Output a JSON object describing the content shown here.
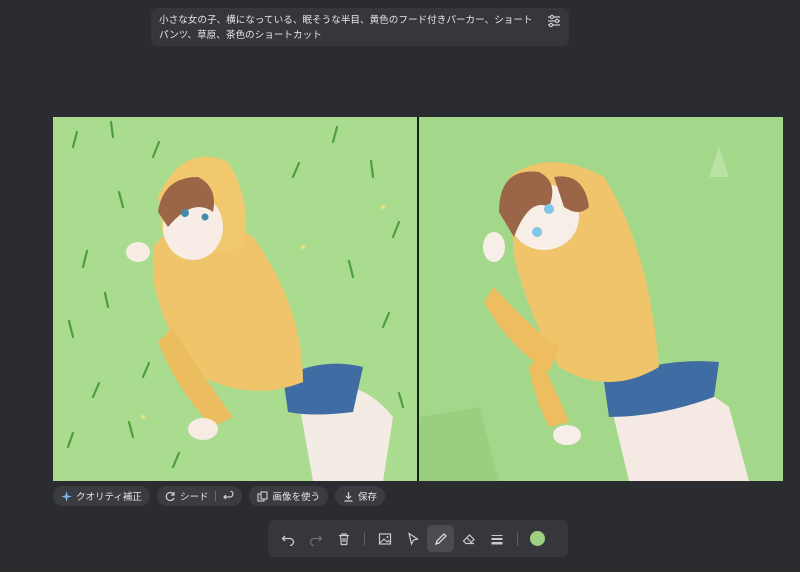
{
  "prompt": {
    "text": "小さな女の子、横になっている、眠そうな半目、黄色のフード付きパーカー、ショートパンツ、草原、茶色のショートカット",
    "settings_icon": "sliders-icon"
  },
  "canvas": {
    "left_panel": "generated-image",
    "right_panel": "sketch-canvas"
  },
  "actions": {
    "quality": "クオリティ補正",
    "seed": "シード",
    "use_image": "画像を使う",
    "save": "保存"
  },
  "toolbar": {
    "tools": [
      "undo-icon",
      "redo-icon",
      "trash-icon",
      "image-icon",
      "select-arrow-icon",
      "pen-icon",
      "eraser-icon",
      "stroke-width-icon"
    ],
    "active_tool": "pen-icon",
    "current_color": "#9ed07f"
  },
  "colors": {
    "background": "#2b2c30",
    "panel": "#36373c",
    "grass": "#a9dc8f",
    "hoodie": "#f0c46a",
    "hair": "#9a6647",
    "shorts": "#3f6da3"
  }
}
